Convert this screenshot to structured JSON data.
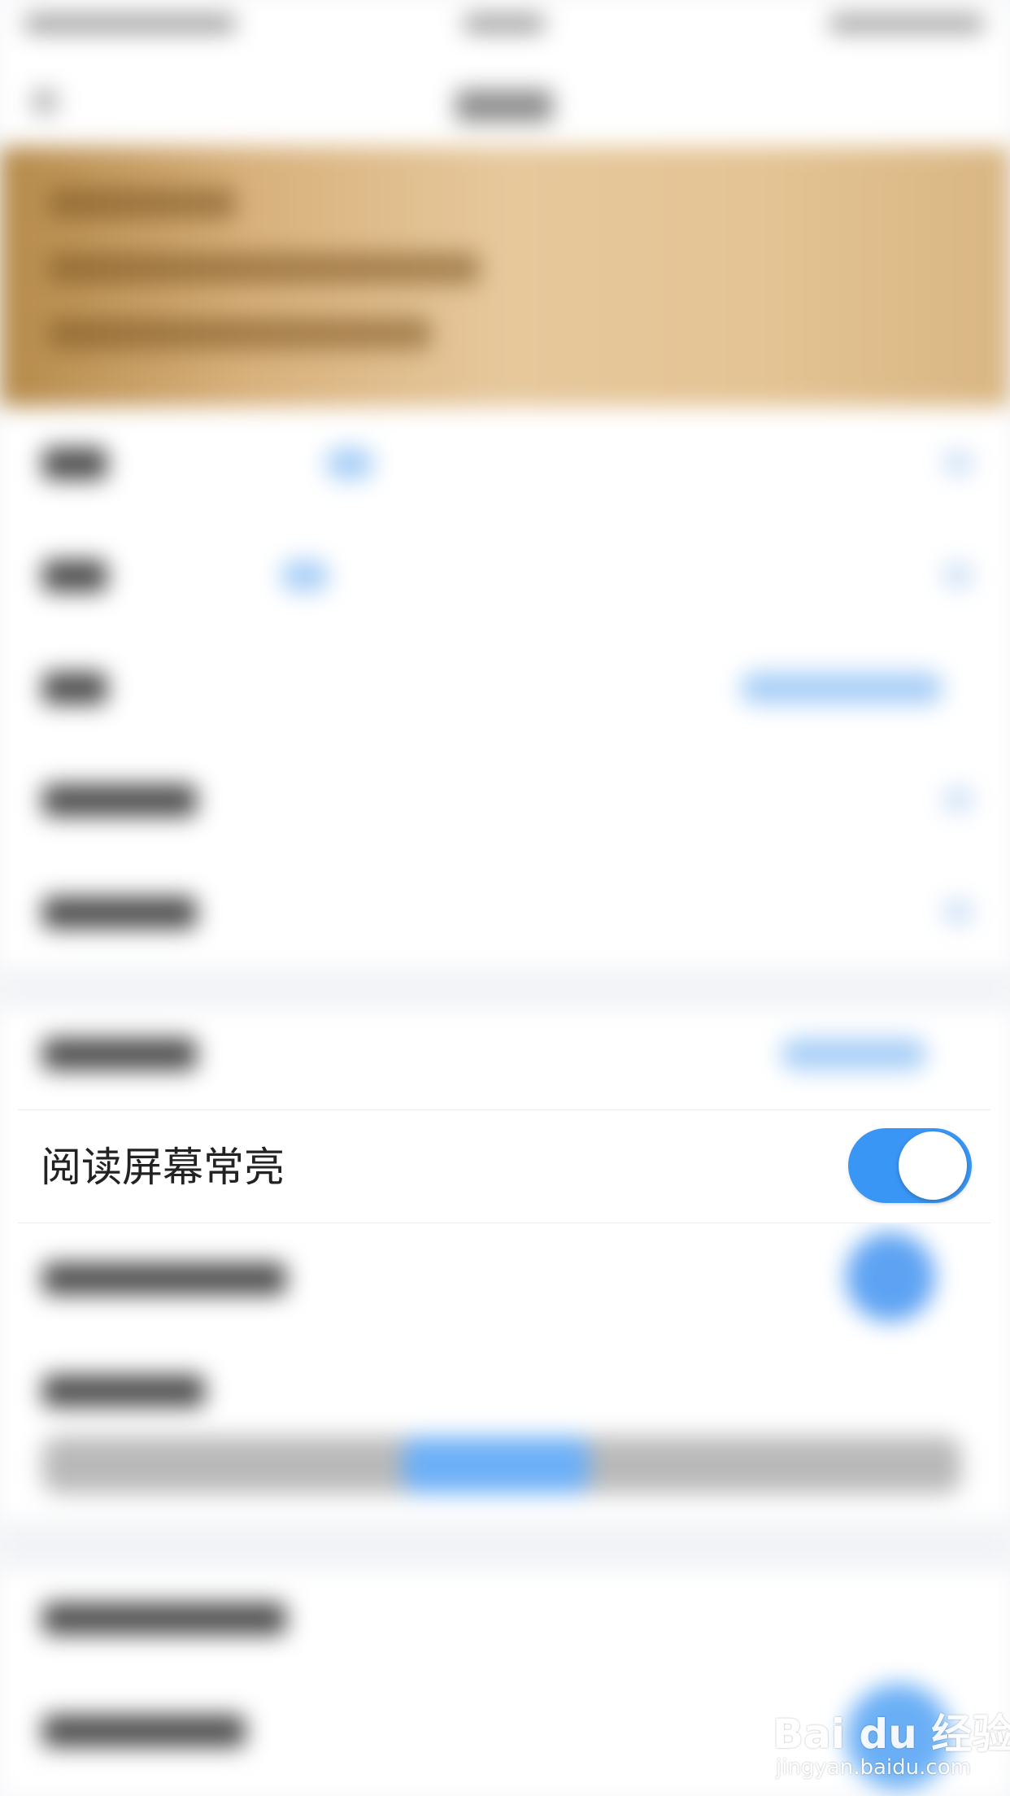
{
  "focused_setting": {
    "label": "阅读屏幕常亮",
    "toggle_on": true,
    "toggle_color": "#3a96f5"
  },
  "banner": {
    "color": "#e6c89c"
  },
  "watermark": {
    "logo": "Bai du 经验",
    "url": "jingyan.baidu.com"
  }
}
